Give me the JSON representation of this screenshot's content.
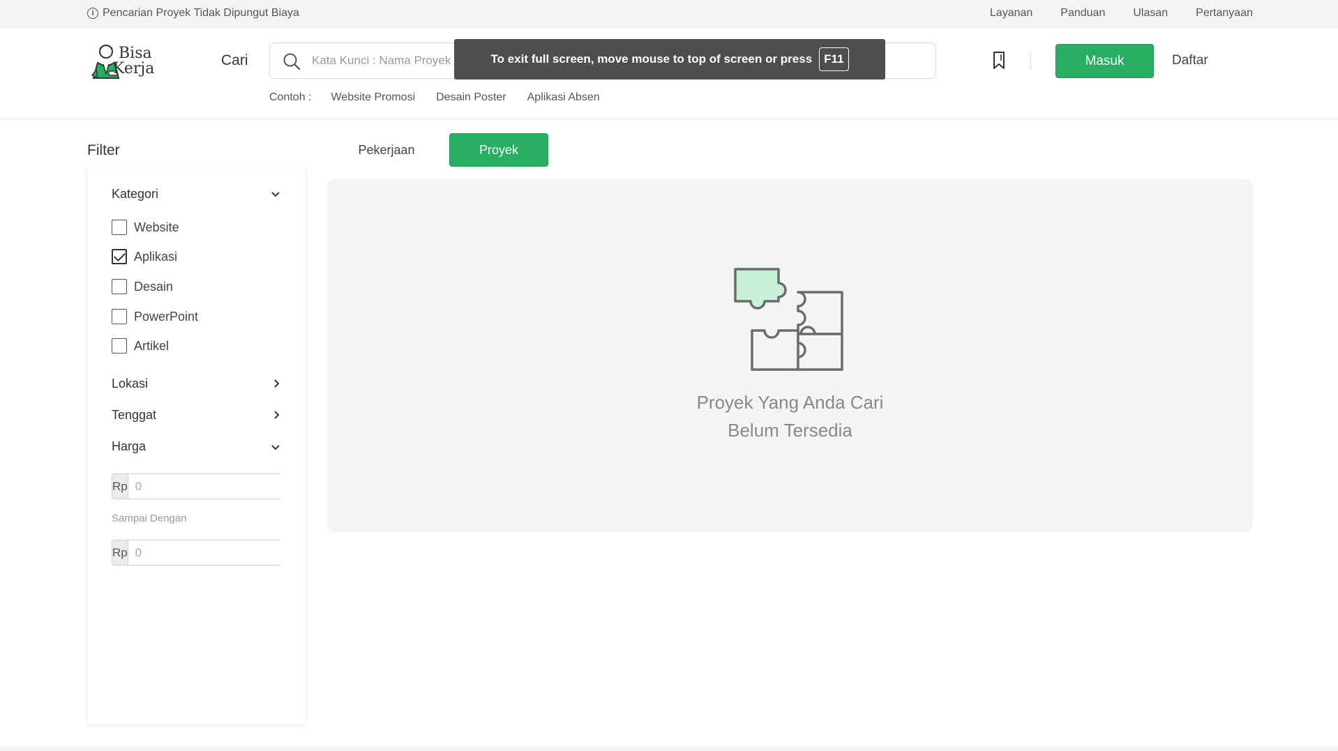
{
  "topbar": {
    "info": "Pencarian Proyek Tidak Dipungut Biaya",
    "links": [
      "Layanan",
      "Panduan",
      "Ulasan",
      "Pertanyaan"
    ]
  },
  "header": {
    "logo_line1": "Bisa",
    "logo_line2": "Kerja",
    "cari_label": "Cari",
    "search_placeholder": "Kata Kunci : Nama Proyek",
    "search_value": "",
    "examples_label": "Contoh :",
    "examples": [
      "Website Promosi",
      "Desain Poster",
      "Aplikasi Absen"
    ],
    "login_label": "Masuk",
    "register_label": "Daftar"
  },
  "toast": {
    "text": "To exit full screen, move mouse to top of screen or press",
    "key": "F11"
  },
  "filter": {
    "title": "Filter",
    "kategori": {
      "label": "Kategori",
      "options": [
        {
          "label": "Website",
          "checked": false
        },
        {
          "label": "Aplikasi",
          "checked": true
        },
        {
          "label": "Desain",
          "checked": false
        },
        {
          "label": "PowerPoint",
          "checked": false
        },
        {
          "label": "Artikel",
          "checked": false
        }
      ]
    },
    "lokasi": "Lokasi",
    "tenggat": "Tenggat",
    "harga": {
      "label": "Harga",
      "currency": "Rp",
      "min_placeholder": "0",
      "between_label": "Sampai Dengan",
      "max_placeholder": "0"
    }
  },
  "tabs": [
    {
      "label": "Pekerjaan",
      "active": false
    },
    {
      "label": "Proyek",
      "active": true
    }
  ],
  "empty_state": {
    "line1": "Proyek Yang Anda Cari",
    "line2": "Belum Tersedia"
  },
  "colors": {
    "brand_green": "#27ae60",
    "puzzle_highlight": "#c8f2d8"
  }
}
